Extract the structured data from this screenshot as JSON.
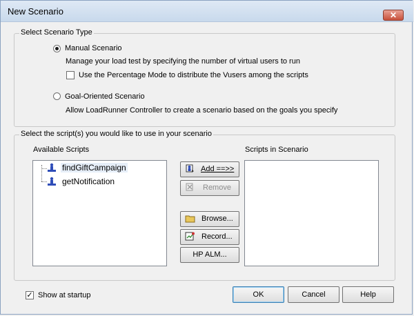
{
  "window": {
    "title": "New Scenario",
    "close_icon": "close-icon"
  },
  "scenario_type": {
    "legend": "Select Scenario Type",
    "manual_label": "Manual Scenario",
    "manual_selected": true,
    "manual_desc": "Manage your load test by specifying the number of virtual users to run",
    "percentage_label": "Use the Percentage Mode to distribute the Vusers among the scripts",
    "percentage_checked": false,
    "goal_label": "Goal-Oriented Scenario",
    "goal_selected": false,
    "goal_desc": "Allow LoadRunner Controller to create a scenario based on the goals you specify"
  },
  "scripts": {
    "legend": "Select the script(s) you would like to use in your scenario",
    "available_label": "Available Scripts",
    "available": [
      "findGiftCampaign",
      "getNotification"
    ],
    "selected_index": 0,
    "in_scenario_label": "Scripts in Scenario",
    "in_scenario": []
  },
  "buttons": {
    "add": "Add ==>>",
    "remove": "Remove",
    "browse": "Browse...",
    "record": "Record...",
    "hpalm": "HP ALM...",
    "ok": "OK",
    "cancel": "Cancel",
    "help": "Help"
  },
  "footer": {
    "show_at_startup_label": "Show at startup",
    "show_at_startup_checked": true
  },
  "colors": {
    "accent": "#3764d7",
    "listbox_border": "#828790",
    "title_gradient_top": "#dfe9f5"
  }
}
